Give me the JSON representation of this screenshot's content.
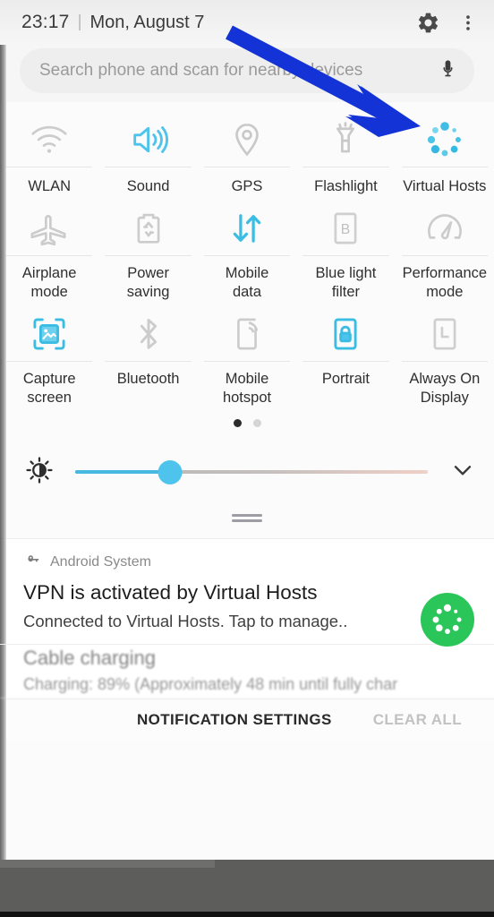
{
  "statusbar": {
    "time": "23:17",
    "separator": "|",
    "date": "Mon, August 7",
    "settings_icon": "gear-icon",
    "overflow_icon": "more-vertical-icon"
  },
  "search": {
    "placeholder": "Search phone and scan for nearby devices",
    "value": "",
    "mic_icon": "microphone-icon"
  },
  "quick_settings": {
    "rows": [
      {
        "tiles": [
          {
            "label": "WLAN",
            "icon": "wifi-icon",
            "state": "off"
          },
          {
            "label": "Sound",
            "icon": "volume-icon",
            "state": "on"
          },
          {
            "label": "GPS",
            "icon": "location-pin-icon",
            "state": "off"
          },
          {
            "label": "Flashlight",
            "icon": "flashlight-icon",
            "state": "off"
          },
          {
            "label": "Virtual Hosts",
            "icon": "dotted-ring-icon",
            "state": "on"
          }
        ]
      },
      {
        "tiles": [
          {
            "label": "Airplane\nmode",
            "icon": "airplane-icon",
            "state": "off"
          },
          {
            "label": "Power\nsaving",
            "icon": "battery-saver-icon",
            "state": "off"
          },
          {
            "label": "Mobile\ndata",
            "icon": "data-arrows-icon",
            "state": "on"
          },
          {
            "label": "Blue light\nfilter",
            "icon": "blue-light-icon",
            "state": "off"
          },
          {
            "label": "Performance\nmode",
            "icon": "speedometer-icon",
            "state": "off"
          }
        ]
      },
      {
        "tiles": [
          {
            "label": "Capture\nscreen",
            "icon": "screenshot-icon",
            "state": "on"
          },
          {
            "label": "Bluetooth",
            "icon": "bluetooth-icon",
            "state": "off"
          },
          {
            "label": "Mobile\nhotspot",
            "icon": "hotspot-icon",
            "state": "off"
          },
          {
            "label": "Portrait",
            "icon": "rotation-lock-icon",
            "state": "on"
          },
          {
            "label": "Always On\nDisplay",
            "icon": "always-on-icon",
            "state": "off"
          }
        ]
      }
    ],
    "pages": {
      "count": 2,
      "active": 1
    }
  },
  "brightness": {
    "icon": "brightness-icon",
    "value_percent": 27,
    "expand_icon": "chevron-down-icon"
  },
  "notifications": [
    {
      "app": "Android System",
      "app_icon": "key-icon",
      "title": "VPN is activated by Virtual Hosts",
      "body": "Connected to Virtual Hosts. Tap to manage..",
      "avatar_icon": "dotted-ring-icon",
      "avatar_color": "#2bc659"
    },
    {
      "title": "Cable charging",
      "body": "Charging: 89% (Approximately 48 min until fully char"
    }
  ],
  "action_bar": {
    "notification_settings": "NOTIFICATION SETTINGS",
    "clear_all": "CLEAR ALL"
  },
  "annotation": {
    "arrow_color": "#1433d6",
    "points_to": "Virtual Hosts"
  },
  "colors": {
    "accent_cyan": "#4ec3ec",
    "tile_off": "#c8c8c8",
    "text_primary": "#2f2f2f"
  }
}
